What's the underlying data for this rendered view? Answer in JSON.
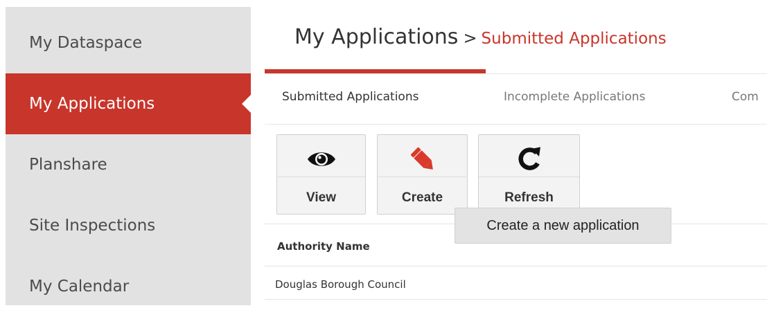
{
  "sidebar": {
    "items": [
      {
        "label": "My Dataspace"
      },
      {
        "label": "My Applications"
      },
      {
        "label": "Planshare"
      },
      {
        "label": "Site Inspections"
      },
      {
        "label": "My Calendar"
      }
    ],
    "active_color": "#c8352b"
  },
  "header": {
    "title": "My Applications",
    "separator": ">",
    "subtitle": "Submitted Applications"
  },
  "tabs": [
    {
      "label": "Submitted Applications"
    },
    {
      "label": "Incomplete Applications"
    },
    {
      "label": "Com"
    }
  ],
  "toolbar": {
    "view_label": "View",
    "view_icon": "eye-icon",
    "create_label": "Create",
    "create_icon": "pencil-icon",
    "refresh_label": "Refresh",
    "refresh_icon": "refresh-icon"
  },
  "tooltip": {
    "text": "Create a new application"
  },
  "table": {
    "columns": [
      "Authority Name"
    ],
    "rows": [
      [
        "Douglas Borough Council"
      ]
    ]
  },
  "colors": {
    "brand": "#c8352b",
    "sidebar_bg": "#e2e2e2"
  }
}
